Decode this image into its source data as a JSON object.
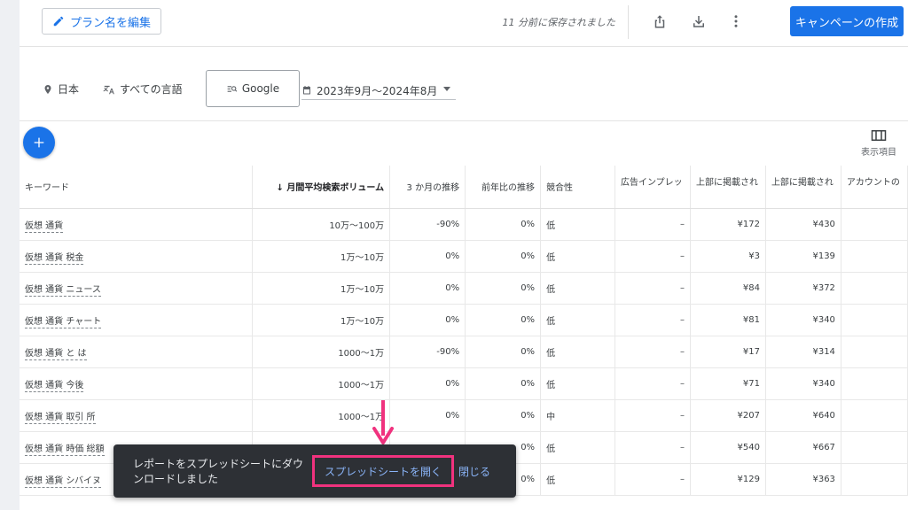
{
  "toolbar": {
    "edit_plan_label": "プラン名を編集",
    "saved_status": "11 分前に保存されました",
    "create_campaign_label": "キャンペーンの作成",
    "icons": [
      "share-icon",
      "download-icon",
      "more-vert-icon"
    ]
  },
  "filters": {
    "location": "日本",
    "language": "すべての言語",
    "network": "Google",
    "date_range": "2023年9月～2024年8月"
  },
  "actions": {
    "columns_label": "表示項目"
  },
  "table": {
    "headers": [
      "キーワード",
      "月間平均検索ボリューム",
      "3 か月の推移",
      "前年比の推移",
      "競合性",
      "広告インプレッ",
      "上部に掲載され",
      "上部に掲載され",
      "アカウントの"
    ],
    "sort_arrow": "↓",
    "rows": [
      {
        "keyword": "仮想 通貨",
        "volume": "10万～100万",
        "three_month": "-90%",
        "yoy": "0%",
        "competition": "低",
        "impression": "–",
        "bid_low": "¥172",
        "bid_high": "¥430"
      },
      {
        "keyword": "仮想 通貨 税金",
        "volume": "1万～10万",
        "three_month": "0%",
        "yoy": "0%",
        "competition": "低",
        "impression": "–",
        "bid_low": "¥3",
        "bid_high": "¥139"
      },
      {
        "keyword": "仮想 通貨 ニュース",
        "volume": "1万～10万",
        "three_month": "0%",
        "yoy": "0%",
        "competition": "低",
        "impression": "–",
        "bid_low": "¥84",
        "bid_high": "¥372"
      },
      {
        "keyword": "仮想 通貨 チャート",
        "volume": "1万～10万",
        "three_month": "0%",
        "yoy": "0%",
        "competition": "低",
        "impression": "–",
        "bid_low": "¥81",
        "bid_high": "¥340"
      },
      {
        "keyword": "仮想 通貨 と は",
        "volume": "1000～1万",
        "three_month": "-90%",
        "yoy": "0%",
        "competition": "低",
        "impression": "–",
        "bid_low": "¥17",
        "bid_high": "¥314"
      },
      {
        "keyword": "仮想 通貨 今後",
        "volume": "1000～1万",
        "three_month": "0%",
        "yoy": "0%",
        "competition": "低",
        "impression": "–",
        "bid_low": "¥71",
        "bid_high": "¥340"
      },
      {
        "keyword": "仮想 通貨 取引 所",
        "volume": "1000～1万",
        "three_month": "0%",
        "yoy": "0%",
        "competition": "中",
        "impression": "–",
        "bid_low": "¥207",
        "bid_high": "¥640"
      },
      {
        "keyword": "仮想 通貨 時価 総額",
        "volume": "",
        "three_month": "",
        "yoy": "0%",
        "competition": "低",
        "impression": "–",
        "bid_low": "¥540",
        "bid_high": "¥667"
      },
      {
        "keyword": "仮想 通貨 シバイヌ",
        "volume": "",
        "three_month": "",
        "yoy": "0%",
        "competition": "低",
        "impression": "–",
        "bid_low": "¥129",
        "bid_high": "¥363"
      }
    ]
  },
  "snackbar": {
    "message": "レポートをスプレッドシートにダウンロードしました",
    "open_label": "スプレッドシートを開く",
    "close_label": "閉じる"
  },
  "colors": {
    "accent": "#1a73e8",
    "highlight": "#f0327e",
    "snackbar_bg": "#2d3035"
  }
}
